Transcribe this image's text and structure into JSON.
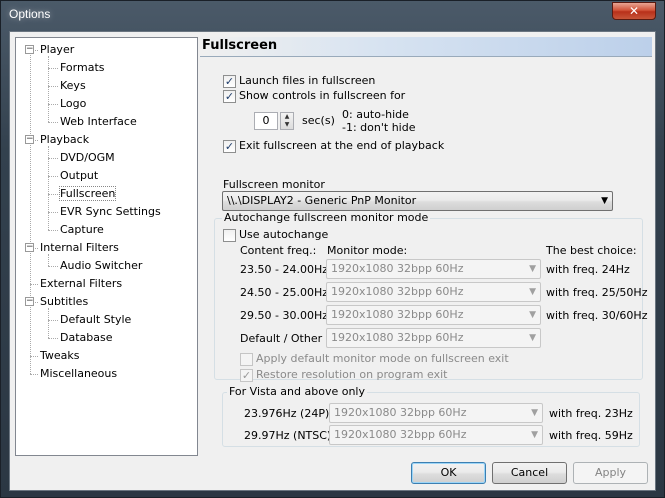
{
  "window": {
    "title": "Options",
    "close_glyph": "✕"
  },
  "tree": {
    "items": [
      {
        "label": "Player",
        "level": 0,
        "expander": "−"
      },
      {
        "label": "Formats",
        "level": 1
      },
      {
        "label": "Keys",
        "level": 1
      },
      {
        "label": "Logo",
        "level": 1
      },
      {
        "label": "Web Interface",
        "level": 1
      },
      {
        "label": "Playback",
        "level": 0,
        "expander": "−"
      },
      {
        "label": "DVD/OGM",
        "level": 1
      },
      {
        "label": "Output",
        "level": 1
      },
      {
        "label": "Fullscreen",
        "level": 1,
        "selected": true
      },
      {
        "label": "EVR Sync Settings",
        "level": 1
      },
      {
        "label": "Capture",
        "level": 1
      },
      {
        "label": "Internal Filters",
        "level": 0,
        "expander": "−"
      },
      {
        "label": "Audio Switcher",
        "level": 1
      },
      {
        "label": "External Filters",
        "level": 0
      },
      {
        "label": "Subtitles",
        "level": 0,
        "expander": "−"
      },
      {
        "label": "Default Style",
        "level": 1
      },
      {
        "label": "Database",
        "level": 1
      },
      {
        "label": "Tweaks",
        "level": 0
      },
      {
        "label": "Miscellaneous",
        "level": 0
      }
    ]
  },
  "panel": {
    "title": "Fullscreen",
    "launch_fullscreen": {
      "label": "Launch files in fullscreen",
      "checked": true
    },
    "show_controls": {
      "label": "Show controls in fullscreen for",
      "checked": true
    },
    "spin": {
      "value": "0",
      "unit": "sec(s)",
      "hint1": "0: auto-hide",
      "hint2": "-1: don't hide"
    },
    "exit_fullscreen": {
      "label": "Exit fullscreen at the end of playback",
      "checked": true
    },
    "monitor_label": "Fullscreen monitor",
    "monitor_value": "\\\\.\\DISPLAY2 - Generic PnP Monitor",
    "autochange_group": "Autochange fullscreen monitor mode",
    "use_autochange": {
      "label": "Use autochange",
      "checked": false
    },
    "col_content": "Content freq.:",
    "col_monitor": "Monitor mode:",
    "col_best": "The best choice:",
    "rows": [
      {
        "freq": "23.50 - 24.00Hz",
        "mode": "1920x1080 32bpp 60Hz",
        "best": "with freq. 24Hz"
      },
      {
        "freq": "24.50 - 25.00Hz",
        "mode": "1920x1080 32bpp 60Hz",
        "best": "with freq. 25/50Hz"
      },
      {
        "freq": "29.50 - 30.00Hz",
        "mode": "1920x1080 32bpp 60Hz",
        "best": "with freq. 30/60Hz"
      },
      {
        "freq": "Default / Other",
        "mode": "1920x1080 32bpp 60Hz",
        "best": ""
      }
    ],
    "apply_default": {
      "label": "Apply default monitor mode on fullscreen exit",
      "checked": false
    },
    "restore_resolution": {
      "label": "Restore resolution on program exit",
      "checked": true
    },
    "vista_group": "For Vista and above only",
    "vista_rows": [
      {
        "freq": "23.976Hz (24P)",
        "mode": "1920x1080 32bpp 60Hz",
        "best": "with freq. 23Hz"
      },
      {
        "freq": "29.97Hz (NTSC)",
        "mode": "1920x1080 32bpp 60Hz",
        "best": "with freq. 59Hz"
      }
    ]
  },
  "buttons": {
    "ok": "OK",
    "cancel": "Cancel",
    "apply": "Apply"
  },
  "glyphs": {
    "check": "✓",
    "dropdown": "▼",
    "spin_up": "▲",
    "spin_down": "▼"
  }
}
